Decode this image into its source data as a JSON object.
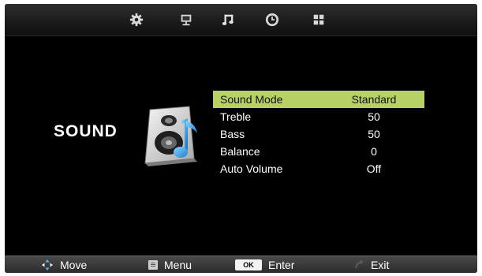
{
  "top_tabs": [
    {
      "name": "picture",
      "icon": "gear-icon"
    },
    {
      "name": "channel",
      "icon": "monitor-icon"
    },
    {
      "name": "sound",
      "icon": "music-note-icon",
      "active": true
    },
    {
      "name": "time",
      "icon": "clock-icon"
    },
    {
      "name": "setup",
      "icon": "grid-icon"
    }
  ],
  "page": {
    "title": "SOUND",
    "icon": "speaker-music-icon"
  },
  "menu": {
    "items": [
      {
        "label": "Sound Mode",
        "value": "Standard",
        "selected": true
      },
      {
        "label": "Treble",
        "value": "50"
      },
      {
        "label": "Bass",
        "value": "50"
      },
      {
        "label": "Balance",
        "value": "0"
      },
      {
        "label": "Auto Volume",
        "value": "Off"
      }
    ]
  },
  "help_bar": {
    "move": "Move",
    "menu": "Menu",
    "ok_key": "OK",
    "enter": "Enter",
    "exit": "Exit"
  },
  "colors": {
    "background": "#000000",
    "selection": "#b8d164",
    "text": "#ffffff"
  }
}
